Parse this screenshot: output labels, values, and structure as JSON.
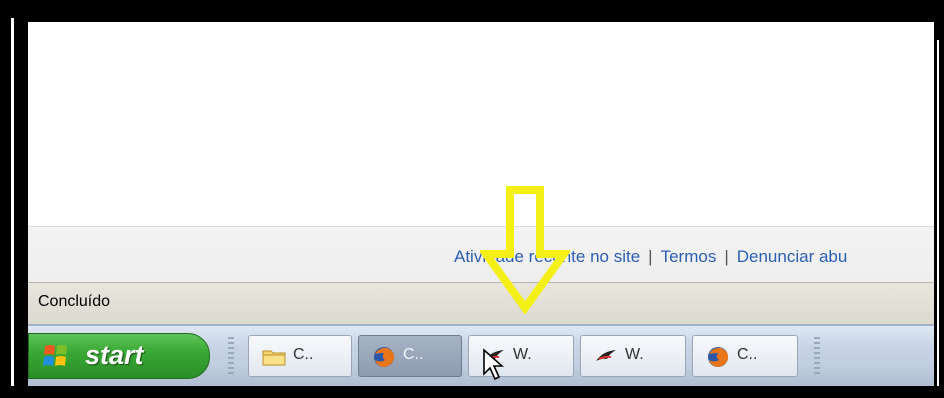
{
  "browser": {
    "footer_links": {
      "recent_activity": "Atividade recente no site",
      "separator1": "|",
      "terms": "Termos",
      "separator2": "|",
      "report_abuse": "Denunciar abu"
    },
    "status_text": "Concluído"
  },
  "taskbar": {
    "start_label": "start",
    "buttons": [
      {
        "label": "C..",
        "icon": "folder-icon",
        "active": false
      },
      {
        "label": "C..",
        "icon": "firefox-icon",
        "active": true
      },
      {
        "label": "W.",
        "icon": "bird-icon",
        "active": false
      },
      {
        "label": "W.",
        "icon": "bird-icon",
        "active": false
      },
      {
        "label": "C..",
        "icon": "firefox-icon",
        "active": false
      }
    ]
  },
  "annotation": {
    "arrow_color": "#f4ef16"
  },
  "colors": {
    "taskbar_blue": "#c6d3e4",
    "start_green": "#3aa935",
    "link_blue": "#2b5fb3"
  }
}
